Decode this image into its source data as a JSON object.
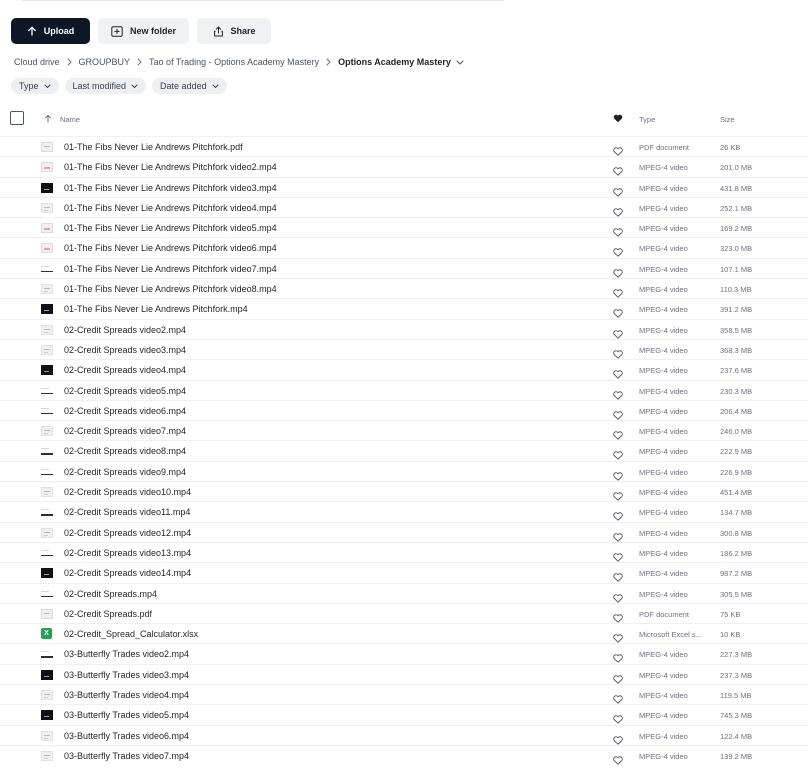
{
  "toolbar": {
    "upload_label": "Upload",
    "new_folder_label": "New folder",
    "share_label": "Share"
  },
  "breadcrumb": {
    "items": [
      "Cloud drive",
      "GROUPBUY",
      "Tao of Trading - Options Academy Mastery"
    ],
    "current": "Options Academy Mastery"
  },
  "filters": {
    "type_label": "Type",
    "last_modified_label": "Last modified",
    "date_added_label": "Date added"
  },
  "table": {
    "columns": {
      "name": "Name",
      "type": "Type",
      "size": "Size"
    },
    "rows": [
      {
        "name": "01-The Fibs Never Lie Andrews Pitchfork.pdf",
        "type": "PDF document",
        "size": "26 KB",
        "thumb": "doc"
      },
      {
        "name": "01-The Fibs Never Lie Andrews Pitchfork video2.mp4",
        "type": "MPEG-4 video",
        "size": "201.0 MB",
        "thumb": "pink"
      },
      {
        "name": "01-The Fibs Never Lie Andrews Pitchfork video3.mp4",
        "type": "MPEG-4 video",
        "size": "431.8 MB",
        "thumb": "dark"
      },
      {
        "name": "01-The Fibs Never Lie Andrews Pitchfork video4.mp4",
        "type": "MPEG-4 video",
        "size": "252.1 MB",
        "thumb": "light"
      },
      {
        "name": "01-The Fibs Never Lie Andrews Pitchfork video5.mp4",
        "type": "MPEG-4 video",
        "size": "169.2 MB",
        "thumb": "pink"
      },
      {
        "name": "01-The Fibs Never Lie Andrews Pitchfork video6.mp4",
        "type": "MPEG-4 video",
        "size": "323.0 MB",
        "thumb": "pink"
      },
      {
        "name": "01-The Fibs Never Lie Andrews Pitchfork video7.mp4",
        "type": "MPEG-4 video",
        "size": "107.1 MB",
        "thumb": "line"
      },
      {
        "name": "01-The Fibs Never Lie Andrews Pitchfork video8.mp4",
        "type": "MPEG-4 video",
        "size": "110.3 MB",
        "thumb": "light"
      },
      {
        "name": "01-The Fibs Never Lie Andrews Pitchfork.mp4",
        "type": "MPEG-4 video",
        "size": "391.2 MB",
        "thumb": "dark"
      },
      {
        "name": "02-Credit Spreads video2.mp4",
        "type": "MPEG-4 video",
        "size": "358.5 MB",
        "thumb": "light"
      },
      {
        "name": "02-Credit Spreads video3.mp4",
        "type": "MPEG-4 video",
        "size": "368.3 MB",
        "thumb": "light"
      },
      {
        "name": "02-Credit Spreads video4.mp4",
        "type": "MPEG-4 video",
        "size": "237.6 MB",
        "thumb": "dark"
      },
      {
        "name": "02-Credit Spreads video5.mp4",
        "type": "MPEG-4 video",
        "size": "230.3 MB",
        "thumb": "line"
      },
      {
        "name": "02-Credit Spreads video6.mp4",
        "type": "MPEG-4 video",
        "size": "206.4 MB",
        "thumb": "line"
      },
      {
        "name": "02-Credit Spreads video7.mp4",
        "type": "MPEG-4 video",
        "size": "246.0 MB",
        "thumb": "light"
      },
      {
        "name": "02-Credit Spreads video8.mp4",
        "type": "MPEG-4 video",
        "size": "222.9 MB",
        "thumb": "line"
      },
      {
        "name": "02-Credit Spreads video9.mp4",
        "type": "MPEG-4 video",
        "size": "226.9 MB",
        "thumb": "line"
      },
      {
        "name": "02-Credit Spreads video10.mp4",
        "type": "MPEG-4 video",
        "size": "451.4 MB",
        "thumb": "light"
      },
      {
        "name": "02-Credit Spreads video11.mp4",
        "type": "MPEG-4 video",
        "size": "134.7 MB",
        "thumb": "line"
      },
      {
        "name": "02-Credit Spreads video12.mp4",
        "type": "MPEG-4 video",
        "size": "300.8 MB",
        "thumb": "light"
      },
      {
        "name": "02-Credit Spreads video13.mp4",
        "type": "MPEG-4 video",
        "size": "186.2 MB",
        "thumb": "line"
      },
      {
        "name": "02-Credit Spreads video14.mp4",
        "type": "MPEG-4 video",
        "size": "987.2 MB",
        "thumb": "dark"
      },
      {
        "name": "02-Credit Spreads.mp4",
        "type": "MPEG-4 video",
        "size": "305.5 MB",
        "thumb": "line"
      },
      {
        "name": "02-Credit Spreads.pdf",
        "type": "PDF document",
        "size": "75 KB",
        "thumb": "doc"
      },
      {
        "name": "02-Credit_Spread_Calculator.xlsx",
        "type": "Microsoft Excel s...",
        "size": "10 KB",
        "thumb": "xlsx"
      },
      {
        "name": "03-Butterfly Trades video2.mp4",
        "type": "MPEG-4 video",
        "size": "227.3 MB",
        "thumb": "line"
      },
      {
        "name": "03-Butterfly Trades video3.mp4",
        "type": "MPEG-4 video",
        "size": "237.3 MB",
        "thumb": "dark"
      },
      {
        "name": "03-Butterfly Trades video4.mp4",
        "type": "MPEG-4 video",
        "size": "119.5 MB",
        "thumb": "light"
      },
      {
        "name": "03-Butterfly Trades video5.mp4",
        "type": "MPEG-4 video",
        "size": "745.3 MB",
        "thumb": "dark"
      },
      {
        "name": "03-Butterfly Trades video6.mp4",
        "type": "MPEG-4 video",
        "size": "122.4 MB",
        "thumb": "light"
      },
      {
        "name": "03-Butterfly Trades video7.mp4",
        "type": "MPEG-4 video",
        "size": "139.2 MB",
        "thumb": "light"
      }
    ]
  },
  "icons": {
    "upload": "arrow-up-icon",
    "new_folder": "folder-plus-icon",
    "share": "share-icon",
    "favorite": "heart-icon",
    "sort": "arrow-up-icon",
    "breadcrumb_separator": "chevron-right-icon",
    "dropdown": "chevron-down-icon",
    "xlsx_letter": "X"
  },
  "colors": {
    "primary_button": "#0d1726",
    "chip_background": "#eeeff1",
    "excel_green": "#21a35a"
  }
}
